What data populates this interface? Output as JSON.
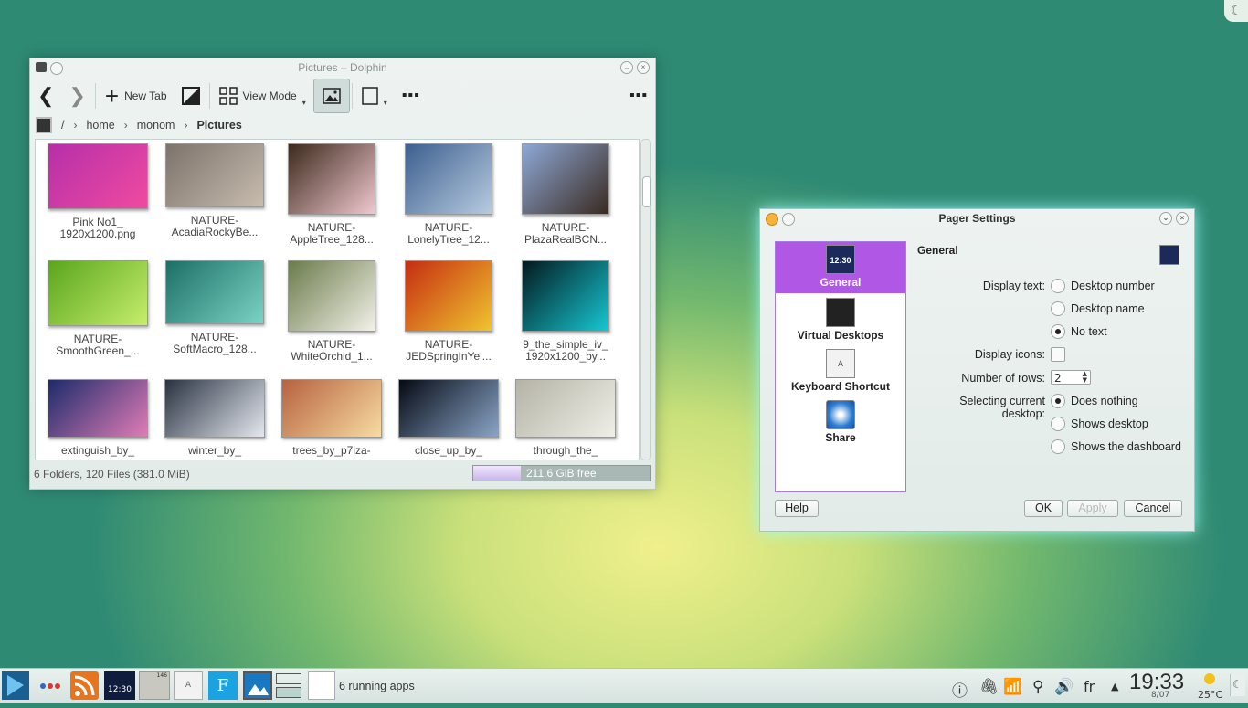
{
  "dolphin": {
    "title": "Pictures – Dolphin",
    "toolbar": {
      "new_tab": "New Tab",
      "view_mode": "View Mode"
    },
    "breadcrumb": [
      "/",
      "home",
      "monom",
      "Pictures"
    ],
    "files": [
      {
        "line1": "Pink No1_",
        "line2": "1920x1200.png",
        "colors": [
          "#b62fa9",
          "#f04aa0"
        ]
      },
      {
        "line1": "NATURE-",
        "line2": "AcadiaRockyBe...",
        "colors": [
          "#7c736b",
          "#c8bcae"
        ]
      },
      {
        "line1": "NATURE-",
        "line2": "AppleTree_128...",
        "colors": [
          "#3c2a1c",
          "#f0c7cf"
        ]
      },
      {
        "line1": "NATURE-",
        "line2": "LonelyTree_12...",
        "colors": [
          "#3d5f8f",
          "#b7cbe0"
        ]
      },
      {
        "line1": "NATURE-",
        "line2": "PlazaRealBCN...",
        "colors": [
          "#8ea8d6",
          "#3a2a20"
        ]
      },
      {
        "line1": "NATURE-",
        "line2": "SmoothGreen_...",
        "colors": [
          "#5aa51d",
          "#c6ee6c"
        ]
      },
      {
        "line1": "NATURE-",
        "line2": "SoftMacro_128...",
        "colors": [
          "#1d6f66",
          "#7ad3c4"
        ]
      },
      {
        "line1": "NATURE-",
        "line2": "WhiteOrchid_1...",
        "colors": [
          "#6b7b4c",
          "#f2f1e7"
        ]
      },
      {
        "line1": "NATURE-",
        "line2": "JEDSpringInYel...",
        "colors": [
          "#c52d12",
          "#f0c42f"
        ]
      },
      {
        "line1": "9_the_simple_iv_",
        "line2": "1920x1200_by...",
        "colors": [
          "#04191e",
          "#17c7d3"
        ]
      },
      {
        "line1": "extinguish_by_",
        "line2": "",
        "colors": [
          "#1c2b6b",
          "#e07cb6"
        ]
      },
      {
        "line1": "winter_by_",
        "line2": "",
        "colors": [
          "#2a3242",
          "#e4e8ee"
        ]
      },
      {
        "line1": "trees_by_p7iza-",
        "line2": "",
        "colors": [
          "#b7623e",
          "#f7dba2"
        ]
      },
      {
        "line1": "close_up_by_",
        "line2": "",
        "colors": [
          "#050a14",
          "#8aa4c6"
        ]
      },
      {
        "line1": "through_the_",
        "line2": "",
        "colors": [
          "#b5b3a6",
          "#efefe8"
        ]
      }
    ],
    "status": "6 Folders, 120 Files (381.0 MiB)",
    "free_space": "211.6 GiB free",
    "used_fraction": 0.27
  },
  "pager": {
    "title": "Pager Settings",
    "sidebar": [
      {
        "label": "General",
        "icon": "clock-icon",
        "selected": true
      },
      {
        "label": "Virtual Desktops",
        "icon": "desktops-icon",
        "selected": false
      },
      {
        "label": "Keyboard Shortcut",
        "icon": "keyboard-icon",
        "selected": false
      },
      {
        "label": "Share",
        "icon": "share-icon",
        "selected": false
      }
    ],
    "clock_icon_text": "12:30",
    "keyboard_icon_text": "A",
    "section_title": "General",
    "display_text_label": "Display text:",
    "display_text_options": [
      "Desktop number",
      "Desktop name",
      "No text"
    ],
    "display_text_selected": "No text",
    "display_icons_label": "Display icons:",
    "display_icons_checked": false,
    "rows_label": "Number of rows:",
    "rows_value": "2",
    "selecting_label": "Selecting current desktop:",
    "selecting_options": [
      "Does nothing",
      "Shows desktop",
      "Shows the dashboard"
    ],
    "selecting_selected": "Does nothing",
    "buttons": {
      "help": "Help",
      "ok": "OK",
      "apply": "Apply",
      "cancel": "Cancel"
    }
  },
  "taskbar": {
    "pager_clock": "12:30",
    "running_apps": "6 running apps",
    "keyboard_layout": "fr",
    "time": "19:33",
    "date": "8/07",
    "temperature": "25°C",
    "keyboard_icon_text": "A",
    "font_icon_text": "F",
    "calc_display": "146"
  },
  "colors": {
    "accent": "#b058e5",
    "window_bg": "#e8efed"
  }
}
